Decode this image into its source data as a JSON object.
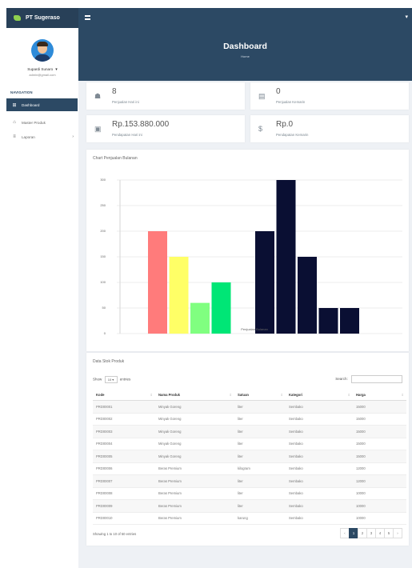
{
  "topbar": {
    "brand": "PT Sugeraso",
    "menu_icon": "hamburger-icon",
    "user_caret": "▾"
  },
  "sidebar": {
    "user_name": "Supardi Sunaro",
    "user_email": "admin@gmail.com",
    "section_label": "NAVIGATION",
    "items": [
      {
        "label": "Dashboard",
        "icon": "⊞",
        "active": true
      },
      {
        "label": "Master Produk",
        "icon": "⌂",
        "active": false
      },
      {
        "label": "Laporan",
        "icon": "≡",
        "active": false,
        "chevron": "›"
      }
    ]
  },
  "header": {
    "title": "Dashboard",
    "subtitle": "Home"
  },
  "stats": [
    {
      "value": "8",
      "label": "Penjualan Hari ini",
      "icon": "☗"
    },
    {
      "value": "0",
      "label": "Penjualan Kemarin",
      "icon": "▤"
    },
    {
      "value": "Rp.153.880.000",
      "label": "Pendapatan Hari ini",
      "icon": "▣"
    },
    {
      "value": "Rp.0",
      "label": "Pendapatan Kemarin",
      "icon": "$"
    }
  ],
  "chart_card": {
    "title": "Chart Penjualan Bulanan",
    "chart_data": {
      "type": "bar",
      "y_ticks": [
        "300",
        "250",
        "200",
        "150",
        "100",
        "50",
        "0"
      ],
      "ylim": [
        0,
        300
      ],
      "x_caption": "Penjualan Bulanan",
      "grid": true,
      "series": [
        {
          "values": [
            200,
            150,
            60,
            100
          ],
          "colors": [
            "#ff7b7b",
            "#ffff66",
            "#80ff80",
            "#00e676"
          ]
        },
        {
          "values": [
            200,
            300,
            150,
            50,
            50
          ],
          "colors": [
            "#0a0f33",
            "#0a0f33",
            "#0a0f33",
            "#0a0f33",
            "#0a0f33"
          ]
        }
      ]
    }
  },
  "table_card": {
    "title": "Data Stok Produk",
    "show_label": "Show",
    "show_value": "10",
    "entries_label": "entries",
    "search_label": "Search:",
    "columns": [
      "Kode",
      "Nama Produk",
      "Satuan",
      "Kategori",
      "Harga"
    ],
    "rows": [
      [
        "PRD00001",
        "Minyak Goreng",
        "liter",
        "Sembako",
        "15000"
      ],
      [
        "PRD00002",
        "Minyak Goreng",
        "liter",
        "Sembako",
        "15000"
      ],
      [
        "PRD00003",
        "Minyak Goreng",
        "liter",
        "Sembako",
        "15000"
      ],
      [
        "PRD00004",
        "Minyak Goreng",
        "liter",
        "Sembako",
        "15000"
      ],
      [
        "PRD00005",
        "Minyak Goreng",
        "liter",
        "Sembako",
        "15000"
      ],
      [
        "PRD00006",
        "Beras Premium",
        "kilogram",
        "Sembako",
        "12000"
      ],
      [
        "PRD00007",
        "Beras Premium",
        "liter",
        "Sembako",
        "12000"
      ],
      [
        "PRD00008",
        "Beras Premium",
        "liter",
        "Sembako",
        "10000"
      ],
      [
        "PRD00009",
        "Beras Premium",
        "liter",
        "Sembako",
        "10000"
      ],
      [
        "PRD00010",
        "Beras Premium",
        "karung",
        "Sembako",
        "10000"
      ]
    ],
    "showing": "Showing 1 to 10 of 50 entries",
    "pager": [
      "‹",
      "1",
      "2",
      "3",
      "4",
      "5",
      "›"
    ],
    "active_page": "1"
  }
}
